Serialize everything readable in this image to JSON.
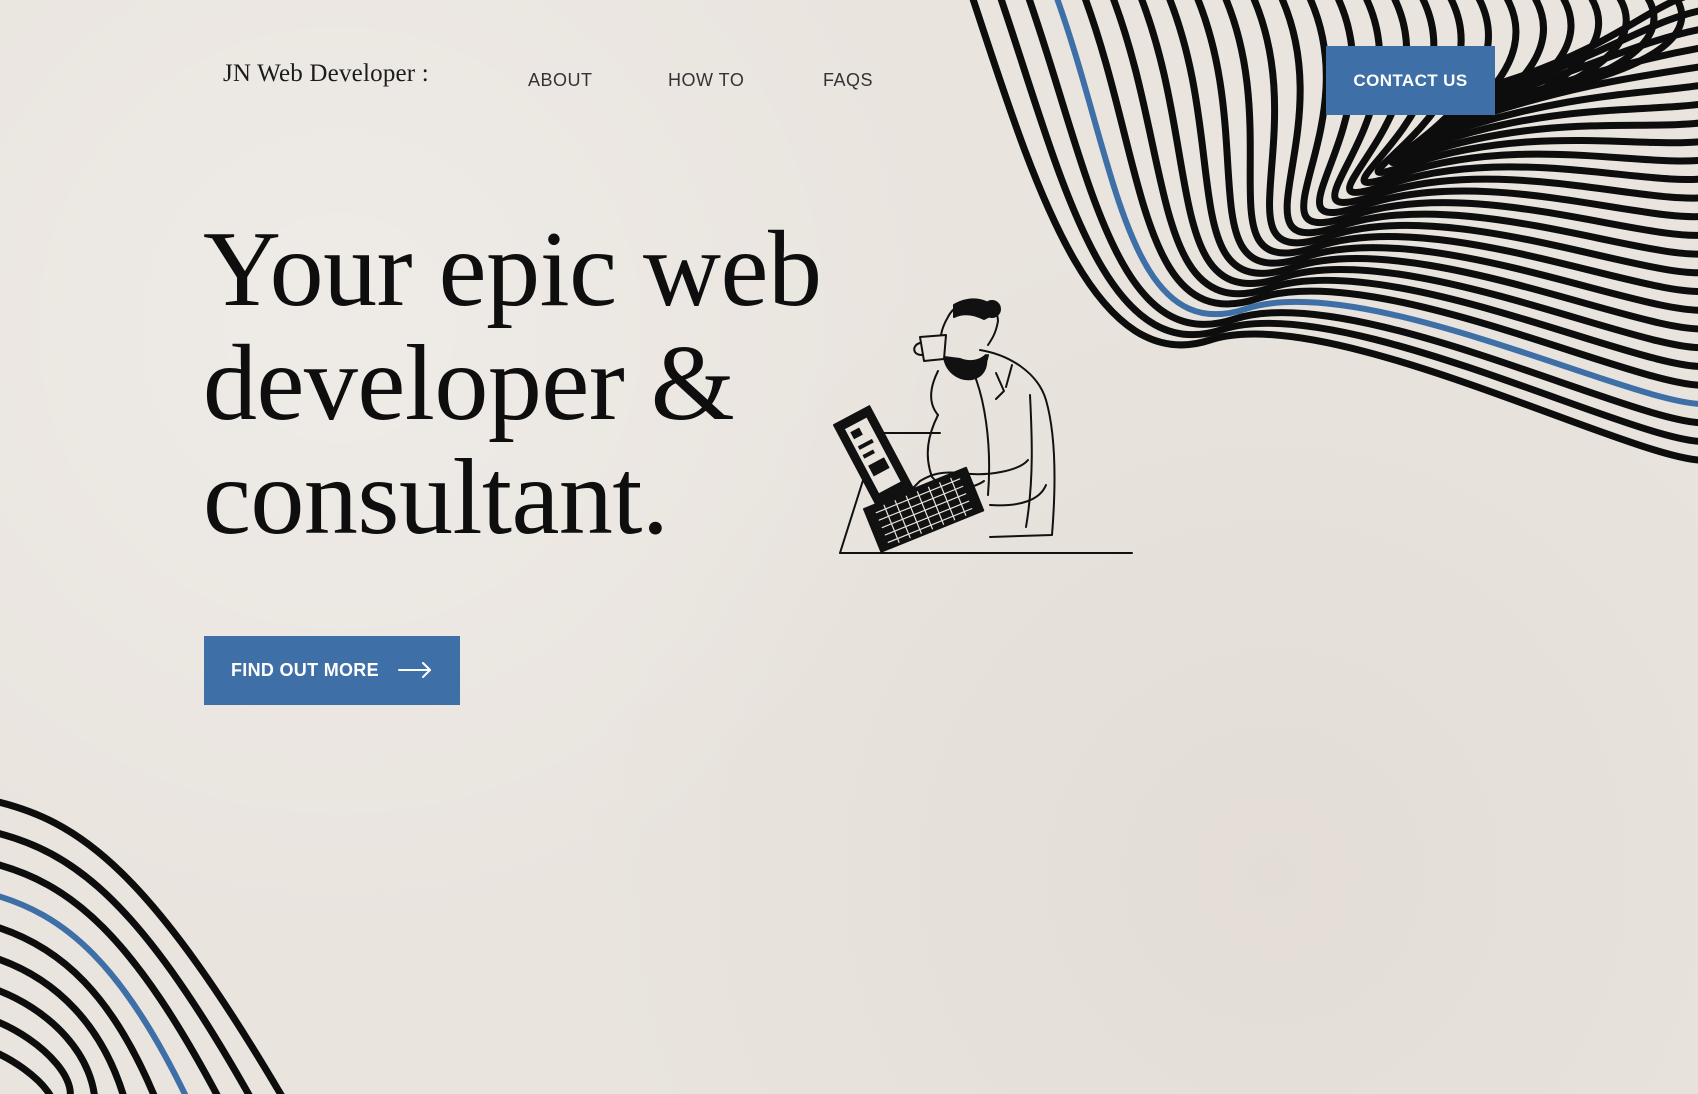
{
  "brand": {
    "name": "JN Web Developer :"
  },
  "nav": {
    "items": [
      {
        "label": "ABOUT"
      },
      {
        "label": "HOW TO"
      },
      {
        "label": "FAQS"
      }
    ]
  },
  "header": {
    "contact_label": "CONTACT US"
  },
  "hero": {
    "title_lines": [
      "Your epic web",
      "developer &",
      "consultant."
    ],
    "cta_label": "FIND OUT MORE",
    "illustration": "man-drinking-coffee-with-laptop"
  },
  "colors": {
    "accent": "#3e6fa6",
    "background": "#e9e4de",
    "ink": "#0e0e0e"
  },
  "icons": {
    "cta_icon": "arrow-right-icon"
  }
}
